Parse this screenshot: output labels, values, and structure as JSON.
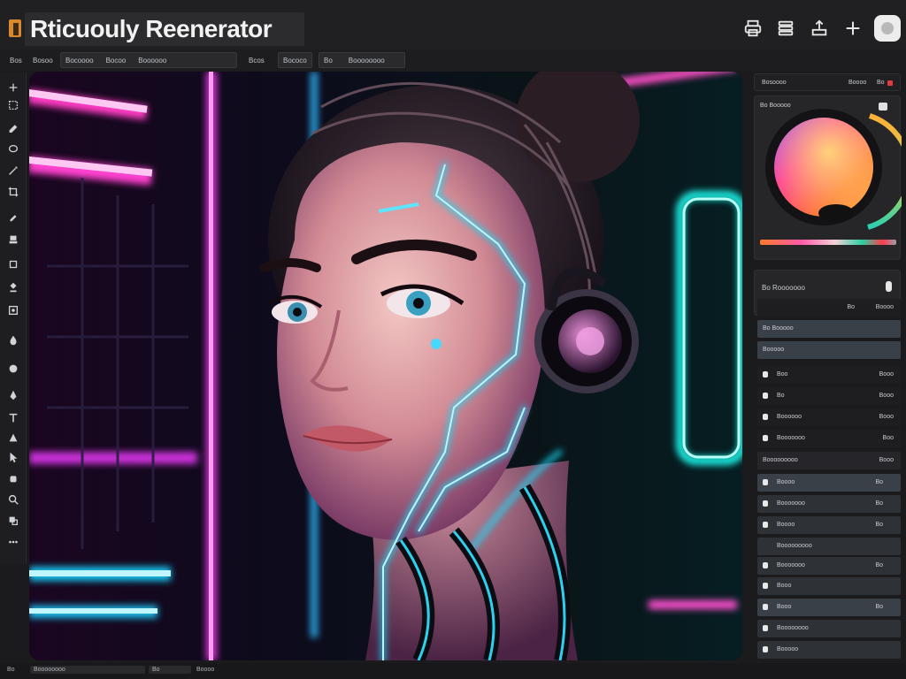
{
  "app": {
    "title": "Rticuouly Reenerator"
  },
  "toolbar": {
    "items": [
      "Bos",
      "Bosoo",
      "Bocoooo",
      "Bocoo",
      "Boooooo",
      "Bcos",
      "Bococo",
      "Bo",
      "Boooooooo"
    ]
  },
  "color_panel": {
    "header_label": "Bosoooo",
    "header_value_1": "Boooo",
    "header_value_2": "Bo",
    "picker_label": "Bo Booooo",
    "accent": "#e23c3c"
  },
  "layers_panel": {
    "title": "Bo Rooooooo",
    "subheader_value_1": "Bo",
    "subheader_value_2": "Boooo",
    "group_rows": [
      "Bo Booooo",
      "Booooo"
    ],
    "rows": [
      {
        "label": "Boo",
        "value": "Booo"
      },
      {
        "label": "Bo",
        "value": "Booo"
      },
      {
        "label": "Boooooo",
        "value": "Booo"
      },
      {
        "label": "Booooooo",
        "value": "Boo"
      }
    ],
    "section_label": "Booooooooo",
    "section_value": "Booo",
    "list": [
      {
        "label": "Boooo",
        "value": "Bo"
      },
      {
        "label": "Booooooo",
        "value": "Bo"
      },
      {
        "label": "Boooo",
        "value": "Bo"
      },
      {
        "label": "Booooooooo",
        "value": ""
      },
      {
        "label": "Booooooo",
        "value": "Bo"
      },
      {
        "label": "Booo",
        "value": ""
      },
      {
        "label": "Booo",
        "value": "Bo"
      },
      {
        "label": "Boooooooo",
        "value": ""
      },
      {
        "label": "Booooo",
        "value": ""
      }
    ]
  },
  "statusbar": {
    "left": "Bo",
    "doc": "Boooooooo",
    "mid_1": "Bo",
    "mid_2": "Boooo"
  }
}
